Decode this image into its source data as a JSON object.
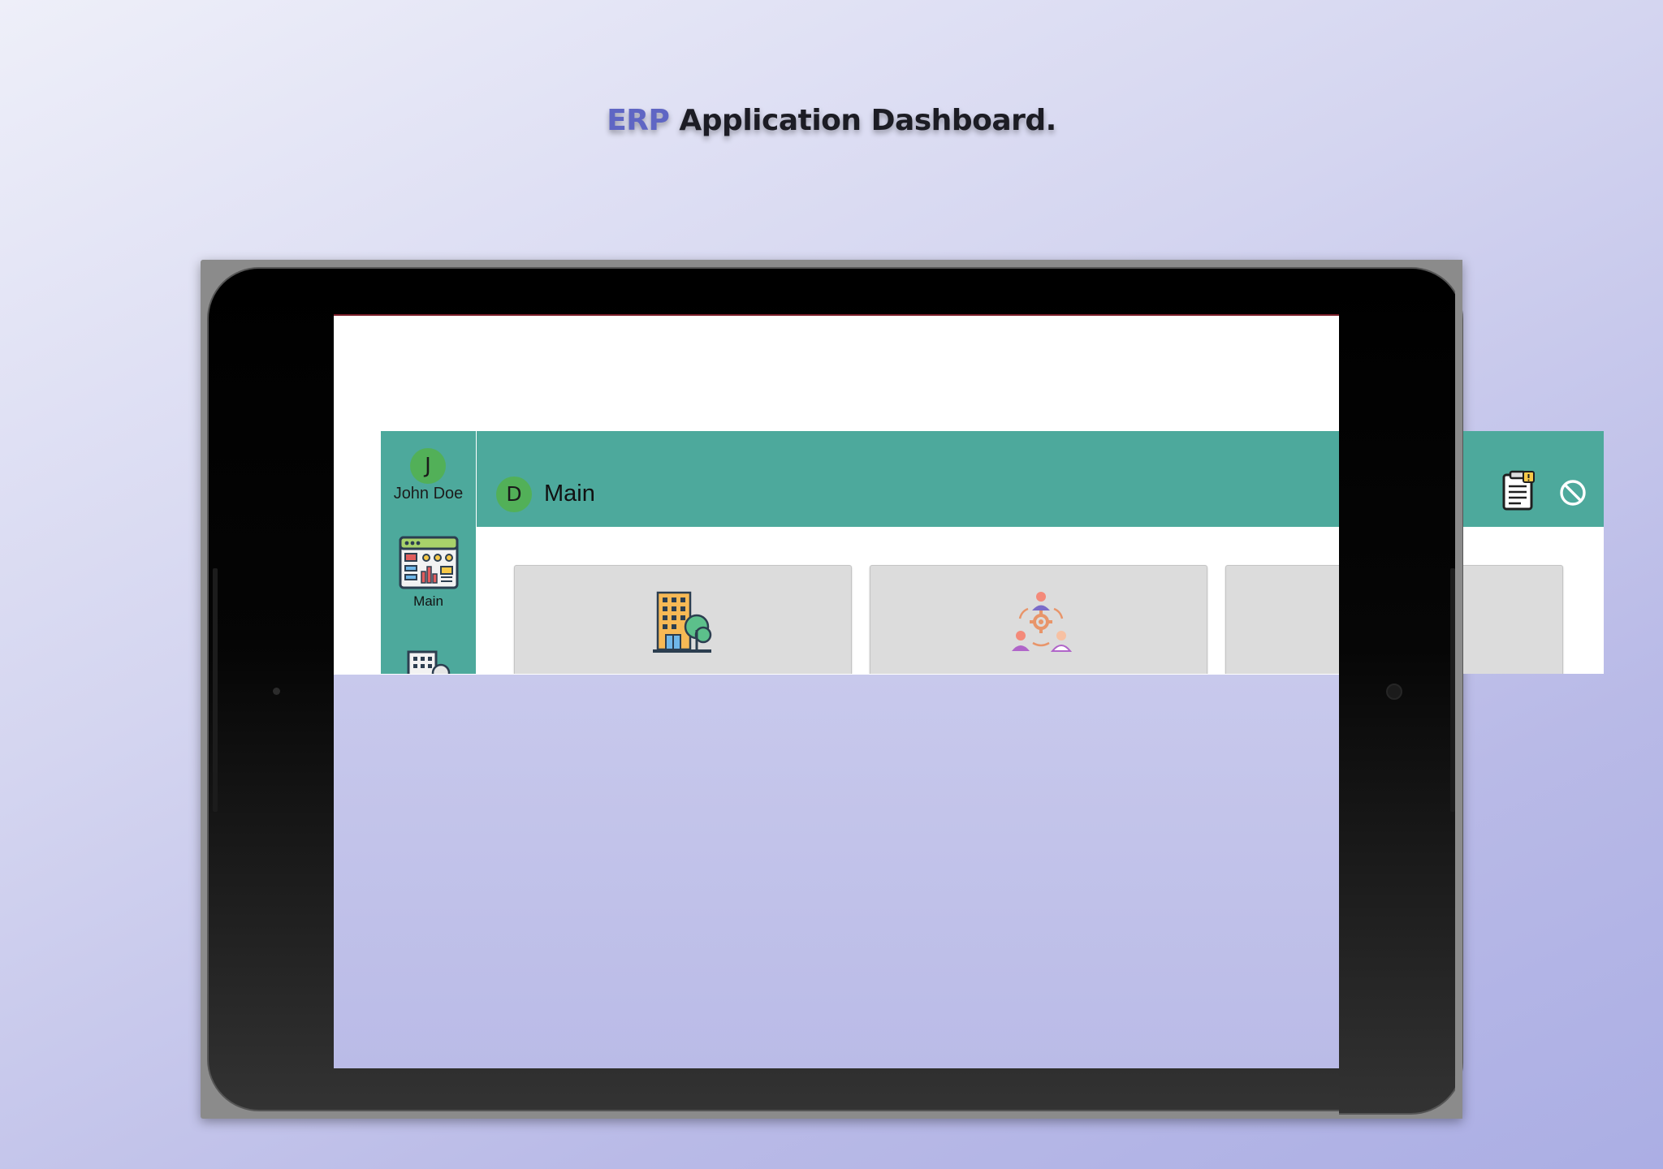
{
  "headline": {
    "accent": "ERP",
    "text": " Application Dashboard."
  },
  "app": {
    "sidebar": {
      "avatar_initial": "J",
      "user_name": "John Doe",
      "items": [
        {
          "label": "Main",
          "icon": "dashboard-icon"
        },
        {
          "label": "",
          "icon": "building-icon"
        }
      ]
    },
    "topbar": {
      "avatar_initial": "D",
      "title": "Main",
      "actions": [
        {
          "icon": "notes-icon"
        },
        {
          "icon": "block-icon"
        }
      ]
    },
    "cards": [
      {
        "icon": "office-building-icon"
      },
      {
        "icon": "team-management-icon"
      },
      {
        "icon": ""
      }
    ]
  },
  "colors": {
    "accent_headline": "#5f66c4",
    "app_teal": "#4da99c",
    "avatar_green": "#52b058",
    "card_gray": "#dcdcdc",
    "background_gradient_start": "#eeeff9",
    "background_gradient_end": "#abaee4"
  }
}
